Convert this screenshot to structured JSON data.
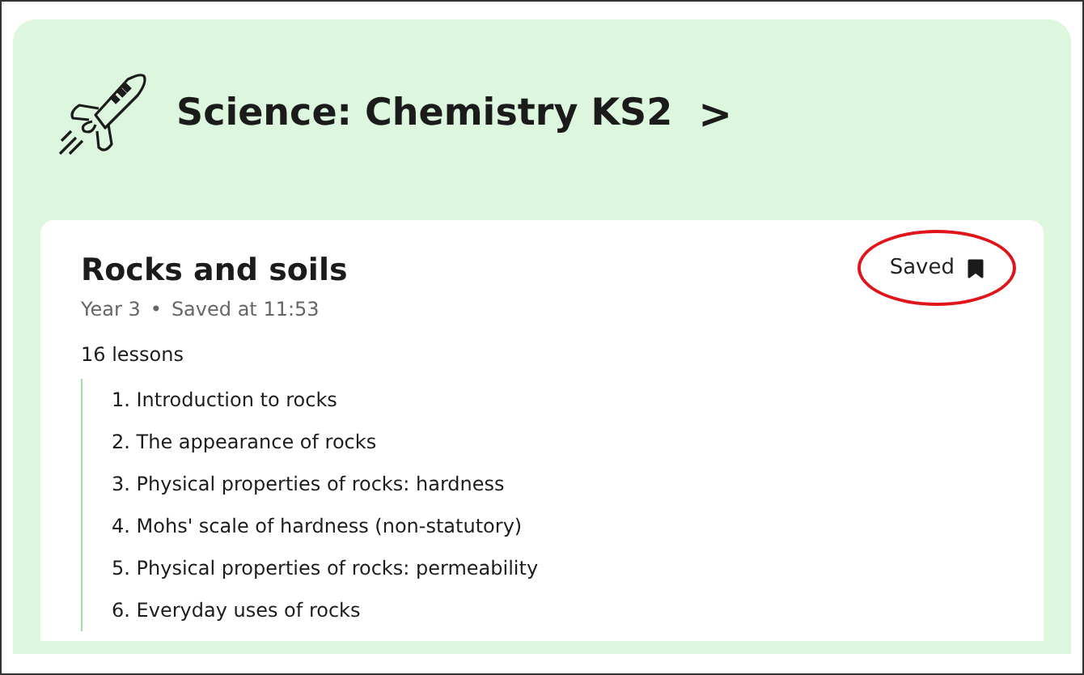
{
  "header": {
    "title": "Science: Chemistry KS2",
    "chevron": ">"
  },
  "unit": {
    "title": "Rocks and soils",
    "year": "Year 3",
    "separator": "•",
    "saved_time": "Saved at 11:53",
    "save_button": {
      "label": "Saved",
      "bookmarked": true,
      "circled": true
    },
    "lesson_count": "16 lessons",
    "lessons": [
      {
        "title": "1. Introduction to rocks"
      },
      {
        "title": "2. The appearance of rocks"
      },
      {
        "title": "3. Physical properties of rocks: hardness"
      },
      {
        "title": "4. Mohs' scale of hardness (non-statutory)"
      },
      {
        "title": "5. Physical properties of rocks: permeability"
      },
      {
        "title": "6. Everyday uses of rocks"
      }
    ]
  }
}
